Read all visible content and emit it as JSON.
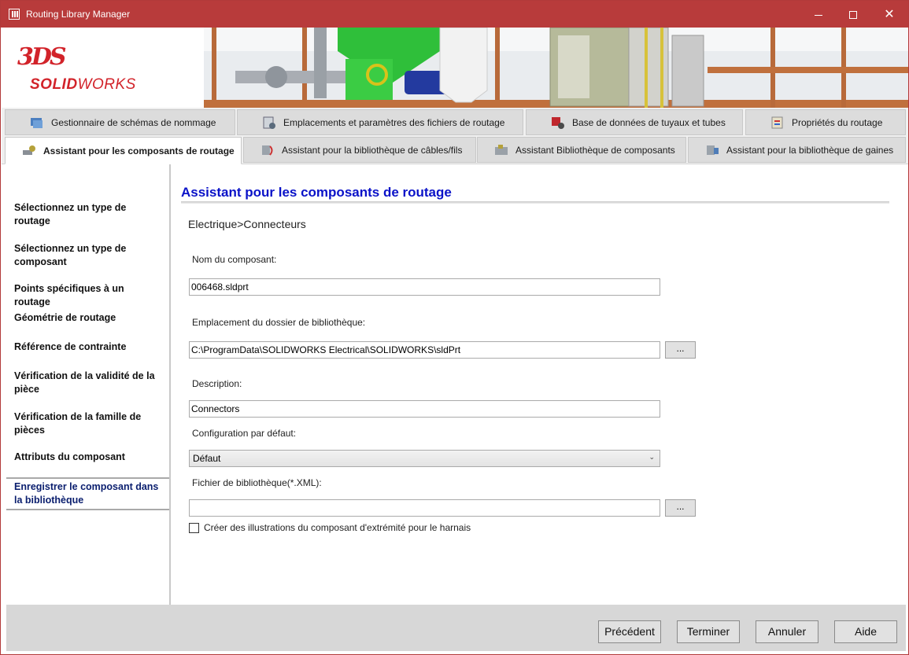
{
  "window": {
    "title": "Routing Library Manager"
  },
  "banner": {
    "logo_mark": "3DS",
    "logo_text_bold": "SOLID",
    "logo_text_light": "WORKS"
  },
  "tabs_row1": [
    {
      "label": "Gestionnaire de schémas de nommage",
      "icon": "naming-scheme-icon"
    },
    {
      "label": "Emplacements et paramètres des fichiers de routage",
      "icon": "file-locations-icon"
    },
    {
      "label": "Base de données de tuyaux et tubes",
      "icon": "pipe-database-icon"
    },
    {
      "label": "Propriétés du routage",
      "icon": "routing-properties-icon"
    }
  ],
  "tabs_row2": [
    {
      "label": "Assistant pour les composants de routage",
      "icon": "component-wizard-icon",
      "active": true
    },
    {
      "label": "Assistant pour la bibliothèque de câbles/fils",
      "icon": "cable-library-icon"
    },
    {
      "label": "Assistant Bibliothèque de composants",
      "icon": "component-library-icon"
    },
    {
      "label": "Assistant pour la bibliothèque de gaines",
      "icon": "covering-library-icon"
    }
  ],
  "nav": {
    "items": [
      {
        "label": "Sélectionnez un type de routage"
      },
      {
        "label": "Sélectionnez un type de composant"
      },
      {
        "label": "Points spécifiques à un routage"
      },
      {
        "label": "Géométrie de routage"
      },
      {
        "label": "Référence de contrainte"
      },
      {
        "label": "Vérification de la validité de la pièce"
      },
      {
        "label": "Vérification de la famille de pièces"
      },
      {
        "label": "Attributs du composant"
      },
      {
        "label": "Enregistrer le composant dans la bibliothèque",
        "selected": true
      }
    ]
  },
  "main": {
    "title": "Assistant pour les composants de routage",
    "breadcrumb": "Electrique>Connecteurs",
    "component_name_label": "Nom du composant:",
    "component_name_value": "006468.sldprt",
    "library_folder_label": "Emplacement du dossier de bibliothèque:",
    "library_folder_value": "C:\\ProgramData\\SOLIDWORKS Electrical\\SOLIDWORKS\\sldPrt",
    "browse_label": "...",
    "description_label": "Description:",
    "description_value": "Connectors",
    "config_label": "Configuration par défaut:",
    "config_value": "Défaut",
    "xml_label": "Fichier de bibliothèque(*.XML):",
    "xml_value": "",
    "harness_checkbox_label": "Créer des illustrations du composant d'extrémité pour le harnais",
    "harness_checked": false
  },
  "footer": {
    "previous": "Précédent",
    "finish": "Terminer",
    "cancel": "Annuler",
    "help": "Aide"
  },
  "colors": {
    "titlebar": "#b83b3b",
    "brand_red": "#d2232a",
    "heading_blue": "#0a12c8"
  }
}
